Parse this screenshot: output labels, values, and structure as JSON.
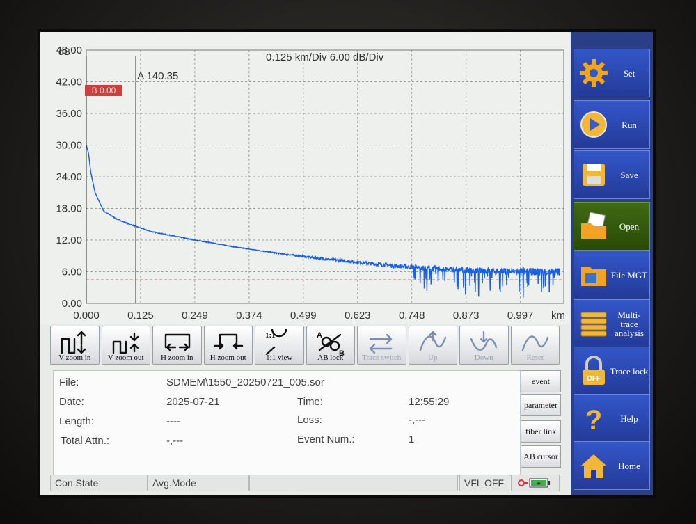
{
  "plot": {
    "y_unit": "dB",
    "scale_info": "0.125 km/Div    6.00 dB/Div",
    "y_ticks": [
      "48.00",
      "42.00",
      "36.00",
      "30.00",
      "24.00",
      "18.00",
      "12.00",
      "6.00",
      "0.00"
    ],
    "x_ticks": [
      "0.000",
      "0.125",
      "0.249",
      "0.374",
      "0.499",
      "0.623",
      "0.748",
      "0.873",
      "0.997"
    ],
    "x_unit": "km",
    "cursor_a_label": "A 140.35",
    "marker_b_label": "B 0.00"
  },
  "chart_data": {
    "type": "line",
    "title": "0.125 km/Div    6.00 dB/Div",
    "xlabel": "km",
    "ylabel": "dB",
    "xlim": [
      0,
      1.1
    ],
    "ylim": [
      0,
      48
    ],
    "grid": true,
    "series": [
      {
        "x": [
          0.0,
          0.005,
          0.01,
          0.02,
          0.04,
          0.07,
          0.1,
          0.15,
          0.2,
          0.25,
          0.3,
          0.35,
          0.4,
          0.45,
          0.5,
          0.55,
          0.6,
          0.65,
          0.7,
          0.75,
          0.8,
          0.85,
          0.9,
          0.95,
          1.0,
          1.05,
          1.09
        ],
        "y": [
          30.0,
          28.5,
          25.0,
          21.0,
          17.5,
          16.0,
          15.0,
          13.6,
          12.8,
          12.0,
          11.3,
          10.6,
          10.0,
          9.4,
          8.9,
          8.4,
          8.0,
          7.6,
          7.2,
          6.9,
          6.6,
          6.4,
          6.2,
          6.1,
          6.0,
          6.0,
          6.0
        ]
      }
    ]
  },
  "toolbar": [
    {
      "label": "V zoom in",
      "icon": "v-zoom-in-icon",
      "enabled": true
    },
    {
      "label": "V zoom out",
      "icon": "v-zoom-out-icon",
      "enabled": true
    },
    {
      "label": "H zoom in",
      "icon": "h-zoom-in-icon",
      "enabled": true
    },
    {
      "label": "H zoom out",
      "icon": "h-zoom-out-icon",
      "enabled": true
    },
    {
      "label": "1:1 view",
      "icon": "magnifier-icon",
      "enabled": true
    },
    {
      "label": "AB lock",
      "icon": "ab-lock-icon",
      "enabled": true
    },
    {
      "label": "Trace switch",
      "icon": "trace-switch-icon",
      "enabled": false
    },
    {
      "label": "Up",
      "icon": "up-icon",
      "enabled": false
    },
    {
      "label": "Down",
      "icon": "down-icon",
      "enabled": false
    },
    {
      "label": "Reset",
      "icon": "reset-icon",
      "enabled": false
    }
  ],
  "info": {
    "file_label": "File:",
    "file_value": "SDMEM\\1550_20250721_005.sor",
    "date_label": "Date:",
    "date_value": "2025-07-21",
    "time_label": "Time:",
    "time_value": "12:55:29",
    "length_label": "Length:",
    "length_value": "----",
    "loss_label": "Loss:",
    "loss_value": "-,---",
    "total_label": "Total Attn.:",
    "total_value": "-,---",
    "event_label": "Event Num.:",
    "event_value": "1"
  },
  "side_buttons": [
    "event",
    "parameter",
    "fiber link",
    "AB cursor"
  ],
  "status": {
    "con_state": "Con.State:",
    "avg_mode": "Avg.Mode",
    "vfl": "VFL OFF"
  },
  "menu": [
    {
      "label": "Set",
      "icon": "gear-icon"
    },
    {
      "label": "Run",
      "icon": "play-icon"
    },
    {
      "label": "Save",
      "icon": "disk-icon"
    },
    {
      "label": "Open",
      "icon": "folder-open-icon",
      "active": true
    },
    {
      "label": "File MGT",
      "icon": "folder-icon"
    },
    {
      "label": "Multi-trace analysis",
      "icon": "stack-icon"
    },
    {
      "label": "Trace lock",
      "icon": "lock-icon"
    },
    {
      "label": "Help",
      "icon": "question-icon"
    },
    {
      "label": "Home",
      "icon": "home-icon"
    }
  ],
  "colors": {
    "trace": "#1a5fe8",
    "menu": "#2a3f86",
    "menu_active": "#3f6a14",
    "marker": "#c94040"
  }
}
